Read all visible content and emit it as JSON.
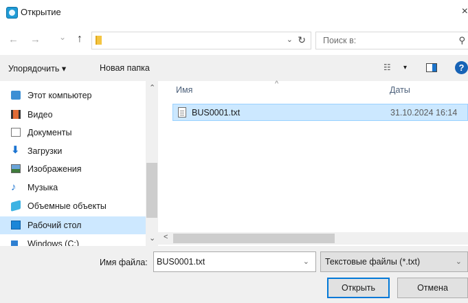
{
  "window": {
    "title": "Открытие",
    "close_glyph": "×"
  },
  "navigation": {
    "back_glyph": "←",
    "forward_glyph": "→",
    "recent_glyph": "⌄",
    "up_glyph": "↑",
    "address_dropdown_glyph": "⌄",
    "refresh_glyph": "↻",
    "search_placeholder": "Поиск в:",
    "search_glyph": "⚲"
  },
  "toolbar": {
    "organize_label": "Упорядочить ▾",
    "new_folder_label": "Новая папка",
    "view_glyph": "☷",
    "view_dropdown_glyph": "▾",
    "help_glyph": "?"
  },
  "sidebar": {
    "items": [
      {
        "label": "Этот компьютер",
        "icon": "computer-icon",
        "selected": false
      },
      {
        "label": "Видео",
        "icon": "video-folder-icon",
        "selected": false
      },
      {
        "label": "Документы",
        "icon": "documents-folder-icon",
        "selected": false
      },
      {
        "label": "Загрузки",
        "icon": "downloads-arrow-icon",
        "selected": false
      },
      {
        "label": "Изображения",
        "icon": "pictures-folder-icon",
        "selected": false
      },
      {
        "label": "Музыка",
        "icon": "music-note-icon",
        "selected": false
      },
      {
        "label": "Объемные объекты",
        "icon": "3d-objects-icon",
        "selected": false
      },
      {
        "label": "Рабочий стол",
        "icon": "desktop-icon",
        "selected": true
      },
      {
        "label": "Windows (C:)",
        "icon": "drive-icon",
        "selected": false
      }
    ],
    "scroll_up_glyph": "⌃",
    "scroll_down_glyph": "⌄"
  },
  "file_list": {
    "columns": {
      "name": "Имя",
      "date": "Даты",
      "sort_glyph": "^"
    },
    "files": [
      {
        "name": "BUS0001.txt",
        "date": "31.10.2024 16:14",
        "selected": true
      }
    ],
    "scroll_left_glyph": "<"
  },
  "footer": {
    "filename_label": "Имя файла:",
    "filename_value": "BUS0001.txt",
    "filename_dropdown_glyph": "⌄",
    "filetype_value": "Текстовые файлы (*.txt)",
    "filetype_dropdown_glyph": "⌄",
    "open_label": "Открыть",
    "cancel_label": "Отмена"
  },
  "colors": {
    "accent": "#0078d7",
    "selection": "#cce8ff",
    "footer_bg": "#f0f0f0"
  }
}
